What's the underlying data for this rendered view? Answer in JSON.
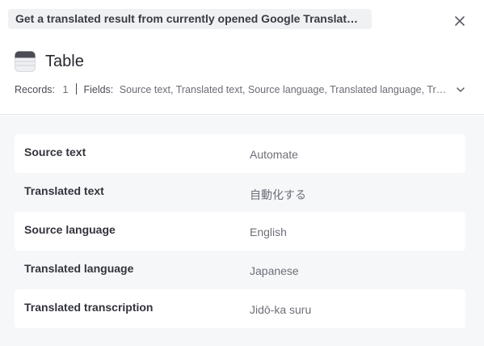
{
  "header": {
    "action_title": "Get a translated result from currently opened Google Translat…",
    "table_title": "Table",
    "records_label": "Records:",
    "records_count": "1",
    "fields_label": "Fields:",
    "fields_value": "Source text, Translated text, Source language, Translated language, Translated transcription"
  },
  "icons": {
    "close": "close-icon",
    "table": "table-icon",
    "expand": "chevron-down-icon"
  },
  "rows": [
    {
      "label": "Source text",
      "value": "Automate"
    },
    {
      "label": "Translated text",
      "value": "自動化する"
    },
    {
      "label": "Source language",
      "value": "English"
    },
    {
      "label": "Translated language",
      "value": "Japanese"
    },
    {
      "label": "Translated transcription",
      "value": "Jidō-ka suru"
    }
  ],
  "colors": {
    "background": "#ffffff",
    "panel": "#f6f7f9",
    "row_highlight": "#ffffff",
    "chip": "#f0f1f3"
  }
}
